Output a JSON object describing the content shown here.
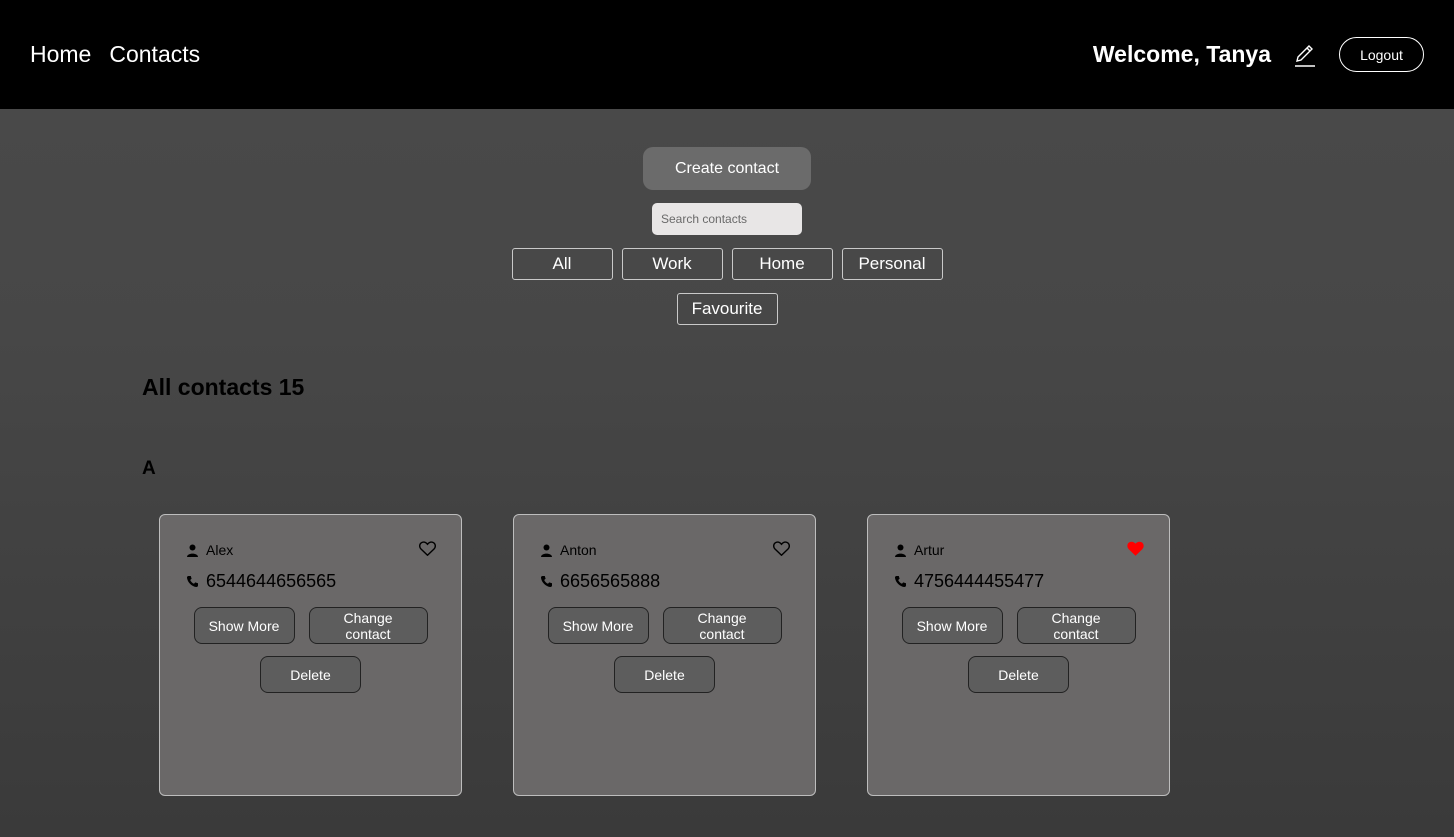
{
  "header": {
    "nav": [
      {
        "label": "Home"
      },
      {
        "label": "Contacts"
      }
    ],
    "welcome": "Welcome, Tanya",
    "logout_label": "Logout",
    "edit_icon": "pencil-icon"
  },
  "controls": {
    "create_label": "Create contact",
    "search_placeholder": "Search contacts",
    "filters": [
      "All",
      "Work",
      "Home",
      "Personal"
    ],
    "favourite_label": "Favourite"
  },
  "list": {
    "title": "All contacts 15",
    "letter": "A"
  },
  "contacts": [
    {
      "name": "Alex",
      "phone": "6544644656565",
      "favourite": false
    },
    {
      "name": "Anton",
      "phone": "6656565888",
      "favourite": false
    },
    {
      "name": "Artur",
      "phone": "4756444455477",
      "favourite": true
    }
  ],
  "card_buttons": {
    "show_more": "Show More",
    "change": "Change contact",
    "delete": "Delete"
  },
  "colors": {
    "header_bg": "#000000",
    "favourite_heart": "#ff0000",
    "card_bg": "#6a6868"
  },
  "icons": {
    "person": "person-icon",
    "phone": "phone-icon",
    "heart": "heart-icon"
  }
}
